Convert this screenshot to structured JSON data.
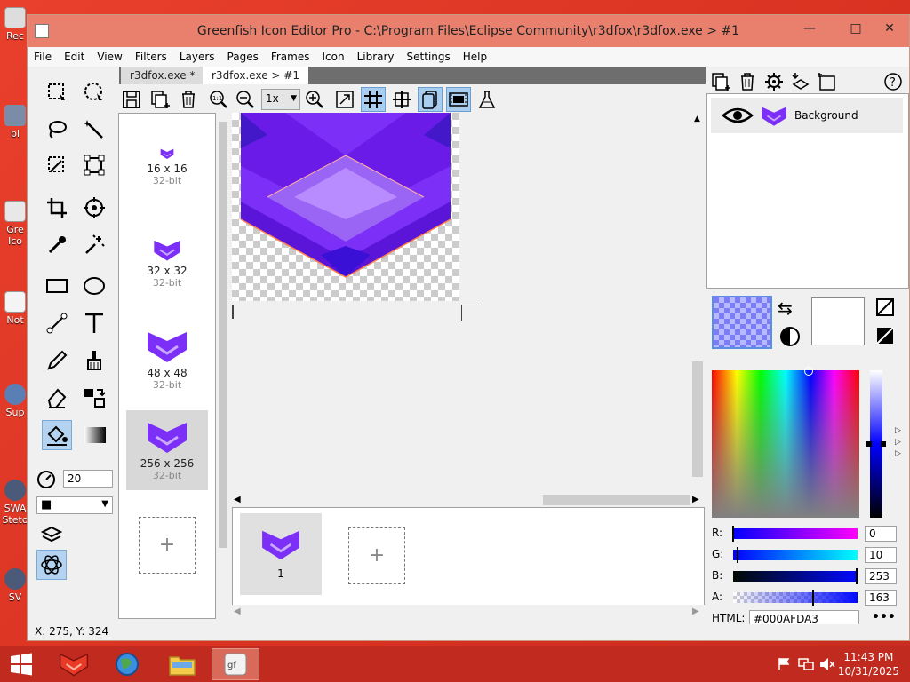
{
  "window": {
    "title": "Greenfish Icon Editor Pro - C:\\Program Files\\Eclipse Community\\r3dfox\\r3dfox.exe > #1",
    "minimize": "—",
    "maximize": "□",
    "close": "✕"
  },
  "menu": [
    "File",
    "Edit",
    "View",
    "Filters",
    "Layers",
    "Pages",
    "Frames",
    "Icon",
    "Library",
    "Settings",
    "Help"
  ],
  "tabs": [
    {
      "label": "r3dfox.exe *",
      "active": false
    },
    {
      "label": "r3dfox.exe > #1",
      "active": true
    }
  ],
  "toolbar": {
    "zoom_value": "1x"
  },
  "tool_options": {
    "size_value": "20",
    "color_select": "■"
  },
  "pages": [
    {
      "dims": "16 x 16",
      "bits": "32-bit"
    },
    {
      "dims": "32 x 32",
      "bits": "32-bit"
    },
    {
      "dims": "48 x 48",
      "bits": "32-bit"
    },
    {
      "dims": "256 x 256",
      "bits": "32-bit",
      "selected": true
    }
  ],
  "add_symbol": "+",
  "frames": [
    {
      "label": "1"
    }
  ],
  "layers": [
    {
      "name": "Background"
    }
  ],
  "color": {
    "labels": {
      "r": "R:",
      "g": "G:",
      "b": "B:",
      "a": "A:",
      "html": "HTML:"
    },
    "r": "0",
    "g": "10",
    "b": "253",
    "a": "163",
    "html": "#000AFDA3",
    "more": "•••",
    "swap_icon": "⇆"
  },
  "status": {
    "coords": "X: 275, Y: 324"
  },
  "desktop_icons": [
    {
      "label": "Rec"
    },
    {
      "label": "bl"
    },
    {
      "label": "Gre Ico"
    },
    {
      "label": "Not"
    },
    {
      "label": "Sup"
    },
    {
      "label": "SWA Steto"
    },
    {
      "label": "SV"
    }
  ],
  "taskbar": {
    "time": "11:43 PM",
    "date": "10/31/2025"
  },
  "colors": {
    "accent": "#7b2ff7",
    "titlebar": "#e8806d",
    "desktop": "#e03524",
    "selection": "#b3d3f0"
  }
}
